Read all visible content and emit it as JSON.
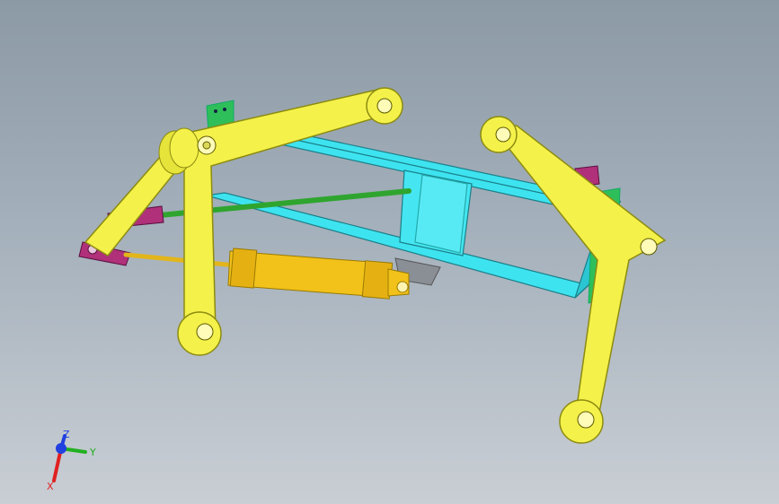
{
  "viewport": {
    "background_top": "#8c9aa6",
    "background_bottom": "#c9ced4"
  },
  "model": {
    "parts": [
      {
        "name": "left-arm",
        "color": "#f4f14a"
      },
      {
        "name": "right-arm",
        "color": "#f4f14a"
      },
      {
        "name": "frame",
        "color": "#3ee3f0"
      },
      {
        "name": "tie-rod",
        "color": "#2fa52f"
      },
      {
        "name": "hydraulic-cylinder",
        "color": "#f2c21a"
      },
      {
        "name": "clevis",
        "color": "#b0307a"
      },
      {
        "name": "mount-plate",
        "color": "#2fbf5a"
      },
      {
        "name": "bracket",
        "color": "#8a8f96"
      }
    ]
  },
  "triad": {
    "x_label": "X",
    "y_label": "Y",
    "z_label": "Z",
    "x_color": "#e02020",
    "y_color": "#20b020",
    "z_color": "#2040e0"
  }
}
